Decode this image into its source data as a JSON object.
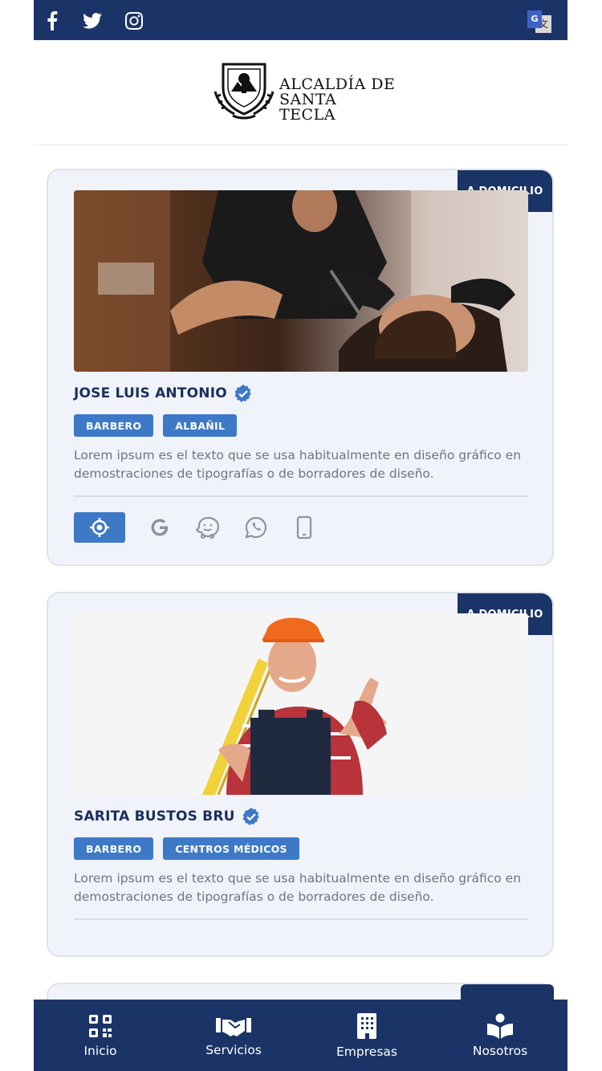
{
  "social": {
    "facebook_icon": "facebook-icon",
    "twitter_icon": "twitter-icon",
    "instagram_icon": "instagram-icon"
  },
  "translate": {
    "g": "G",
    "x": "文"
  },
  "logo": {
    "line1": "ALCALDÍA DE",
    "line2": "SANTA TECLA"
  },
  "cards": [
    {
      "badge": "A DOMICILIO",
      "name": "JOSE LUIS ANTONIO",
      "tags": [
        "BARBERO",
        "ALBAÑIL"
      ],
      "description": "Lorem ipsum es el texto que se usa habitualmente en diseño gráfico en demostraciones de tipografías o de borradores de diseño."
    },
    {
      "badge": "A DOMICILIO",
      "name": "SARITA BUSTOS BRU",
      "tags": [
        "BARBERO",
        "CENTROS MÉDICOS"
      ],
      "description": "Lorem ipsum es el texto que se usa habitualmente en diseño gráfico en demostraciones de tipografías o de borradores de diseño."
    }
  ],
  "nav": [
    {
      "label": "Inicio",
      "icon": "qr-icon"
    },
    {
      "label": "Servicios",
      "icon": "handshake-icon"
    },
    {
      "label": "Empresas",
      "icon": "building-icon"
    },
    {
      "label": "Nosotros",
      "icon": "book-reader-icon"
    }
  ],
  "colors": {
    "primary": "#1b3467",
    "accent": "#3e79c7",
    "card_bg": "#f0f3f9",
    "text_muted": "#6b7687"
  }
}
